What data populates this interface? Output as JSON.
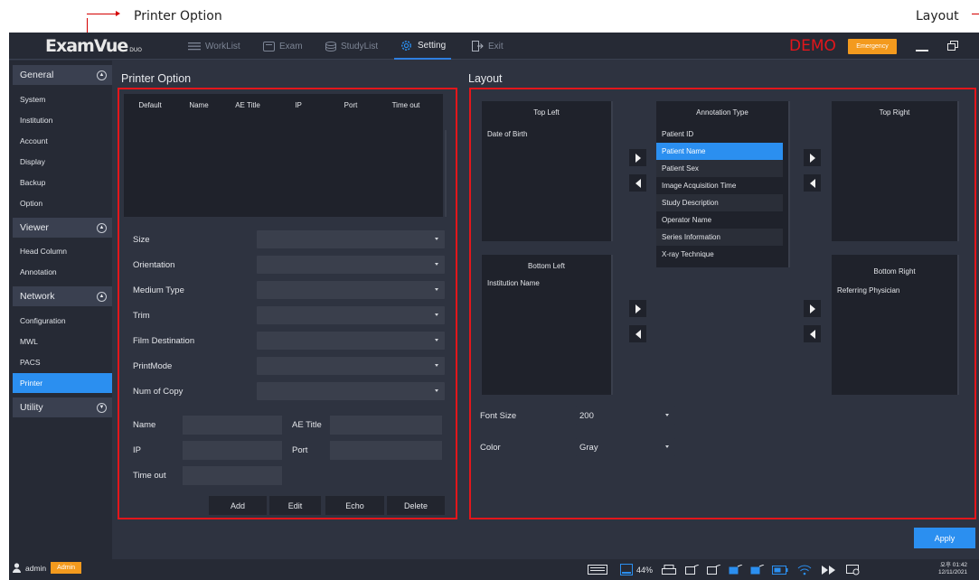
{
  "annotations": {
    "left": "Printer Option",
    "right": "Layout"
  },
  "app": {
    "logo_main": "ExamVue",
    "logo_sub": "DUO",
    "demo": "DEMO",
    "emergency": "Emergency"
  },
  "nav": {
    "worklist": "WorkList",
    "exam": "Exam",
    "studylist": "StudyList",
    "setting": "Setting",
    "exit": "Exit"
  },
  "sidebar": {
    "general": "General",
    "general_items": [
      "System",
      "Institution",
      "Account",
      "Display",
      "Backup",
      "Option"
    ],
    "viewer": "Viewer",
    "viewer_items": [
      "Head Column",
      "Annotation"
    ],
    "network": "Network",
    "network_items": [
      "Configuration",
      "MWL",
      "PACS",
      "Printer"
    ],
    "utility": "Utility"
  },
  "printer": {
    "title": "Printer Option",
    "columns": [
      "Default",
      "Name",
      "AE Title",
      "IP",
      "Port",
      "Time out"
    ],
    "fields": [
      "Size",
      "Orientation",
      "Medium Type",
      "Trim",
      "Film Destination",
      "PrintMode",
      "Num of Copy"
    ],
    "name_label": "Name",
    "aetitle_label": "AE Title",
    "ip_label": "IP",
    "port_label": "Port",
    "timeout_label": "Time out",
    "buttons": {
      "add": "Add",
      "edit": "Edit",
      "echo": "Echo",
      "delete": "Delete"
    }
  },
  "layout": {
    "title": "Layout",
    "top_left": {
      "header": "Top Left",
      "items": [
        "Date of Birth"
      ]
    },
    "annotation_type": {
      "header": "Annotation Type",
      "items": [
        "Patient ID",
        "Patient Name",
        "Patient Sex",
        "Image Acquisition Time",
        "Study Description",
        "Operator Name",
        "Series Information",
        "X-ray Technique"
      ],
      "selected": "Patient Name"
    },
    "top_right": {
      "header": "Top Right",
      "items": []
    },
    "bottom_left": {
      "header": "Bottom Left",
      "items": [
        "Institution Name"
      ]
    },
    "bottom_right": {
      "header": "Bottom Right",
      "items": [
        "Referring Physician"
      ]
    },
    "font_size_label": "Font Size",
    "font_size_value": "200",
    "color_label": "Color",
    "color_value": "Gray",
    "apply": "Apply"
  },
  "statusbar": {
    "user": "admin",
    "role": "Admin",
    "battery": "44%",
    "time": "오후 01:42",
    "date": "12/11/2021"
  },
  "colors": {
    "accent": "#2b8ff0",
    "alert": "#e3161b",
    "badge": "#f39a1e",
    "bg": "#2e3340"
  }
}
